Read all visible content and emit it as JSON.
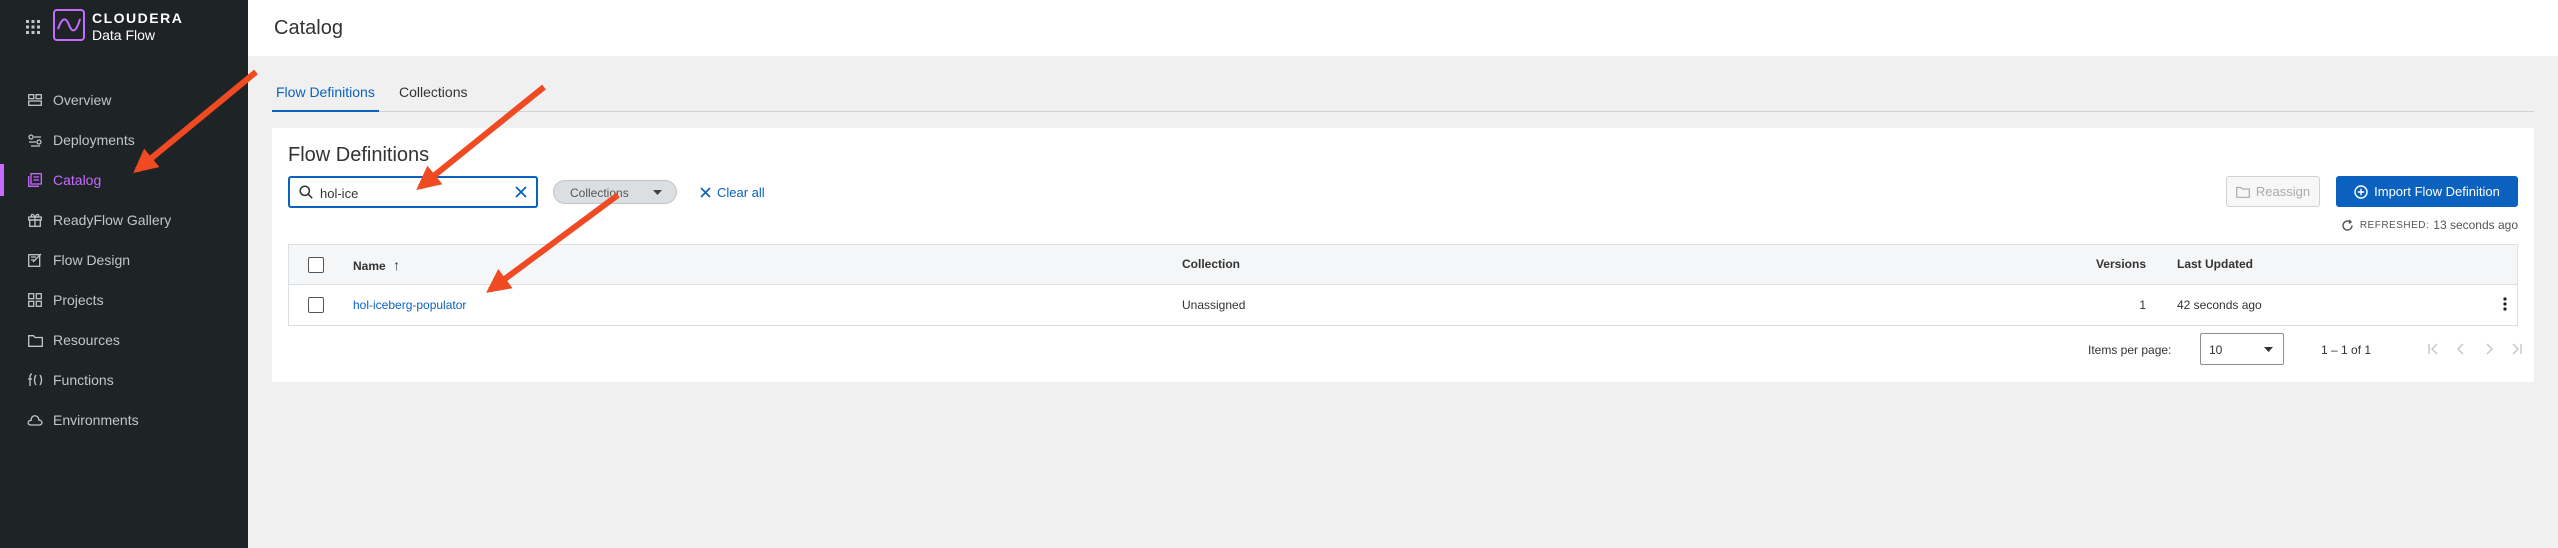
{
  "brand": {
    "name": "CLOUDERA",
    "product": "Data Flow"
  },
  "sidebar": {
    "items": [
      {
        "label": "Overview",
        "icon": "overview-icon"
      },
      {
        "label": "Deployments",
        "icon": "deployments-icon"
      },
      {
        "label": "Catalog",
        "icon": "catalog-icon",
        "active": true
      },
      {
        "label": "ReadyFlow Gallery",
        "icon": "gift-icon"
      },
      {
        "label": "Flow Design",
        "icon": "flow-design-icon"
      },
      {
        "label": "Projects",
        "icon": "projects-icon"
      },
      {
        "label": "Resources",
        "icon": "folder-icon"
      },
      {
        "label": "Functions",
        "icon": "function-icon"
      },
      {
        "label": "Environments",
        "icon": "cloud-icon"
      }
    ]
  },
  "header": {
    "title": "Catalog"
  },
  "tabs": [
    {
      "label": "Flow Definitions",
      "active": true
    },
    {
      "label": "Collections",
      "active": false
    }
  ],
  "panel": {
    "title": "Flow Definitions",
    "search_value": "hol-ice",
    "filter_chip": "Collections",
    "clear_all": "Clear all",
    "reassign": "Reassign",
    "import": "Import Flow Definition",
    "refreshed_label": "REFRESHED:",
    "refreshed_value": "13 seconds ago"
  },
  "table": {
    "columns": {
      "name": "Name",
      "collection": "Collection",
      "versions": "Versions",
      "last_updated": "Last Updated"
    },
    "sort_indicator": "↑",
    "rows": [
      {
        "name": "hol-iceberg-populator",
        "collection": "Unassigned",
        "versions": "1",
        "last_updated": "42 seconds ago"
      }
    ]
  },
  "pagination": {
    "items_per_page_label": "Items per page:",
    "items_per_page": "10",
    "range": "1 – 1 of 1"
  },
  "colors": {
    "sidebar_bg": "#1e2326",
    "accent_purple": "#c66bff",
    "primary_blue": "#0a62be",
    "annotation_red": "#f04a23"
  }
}
